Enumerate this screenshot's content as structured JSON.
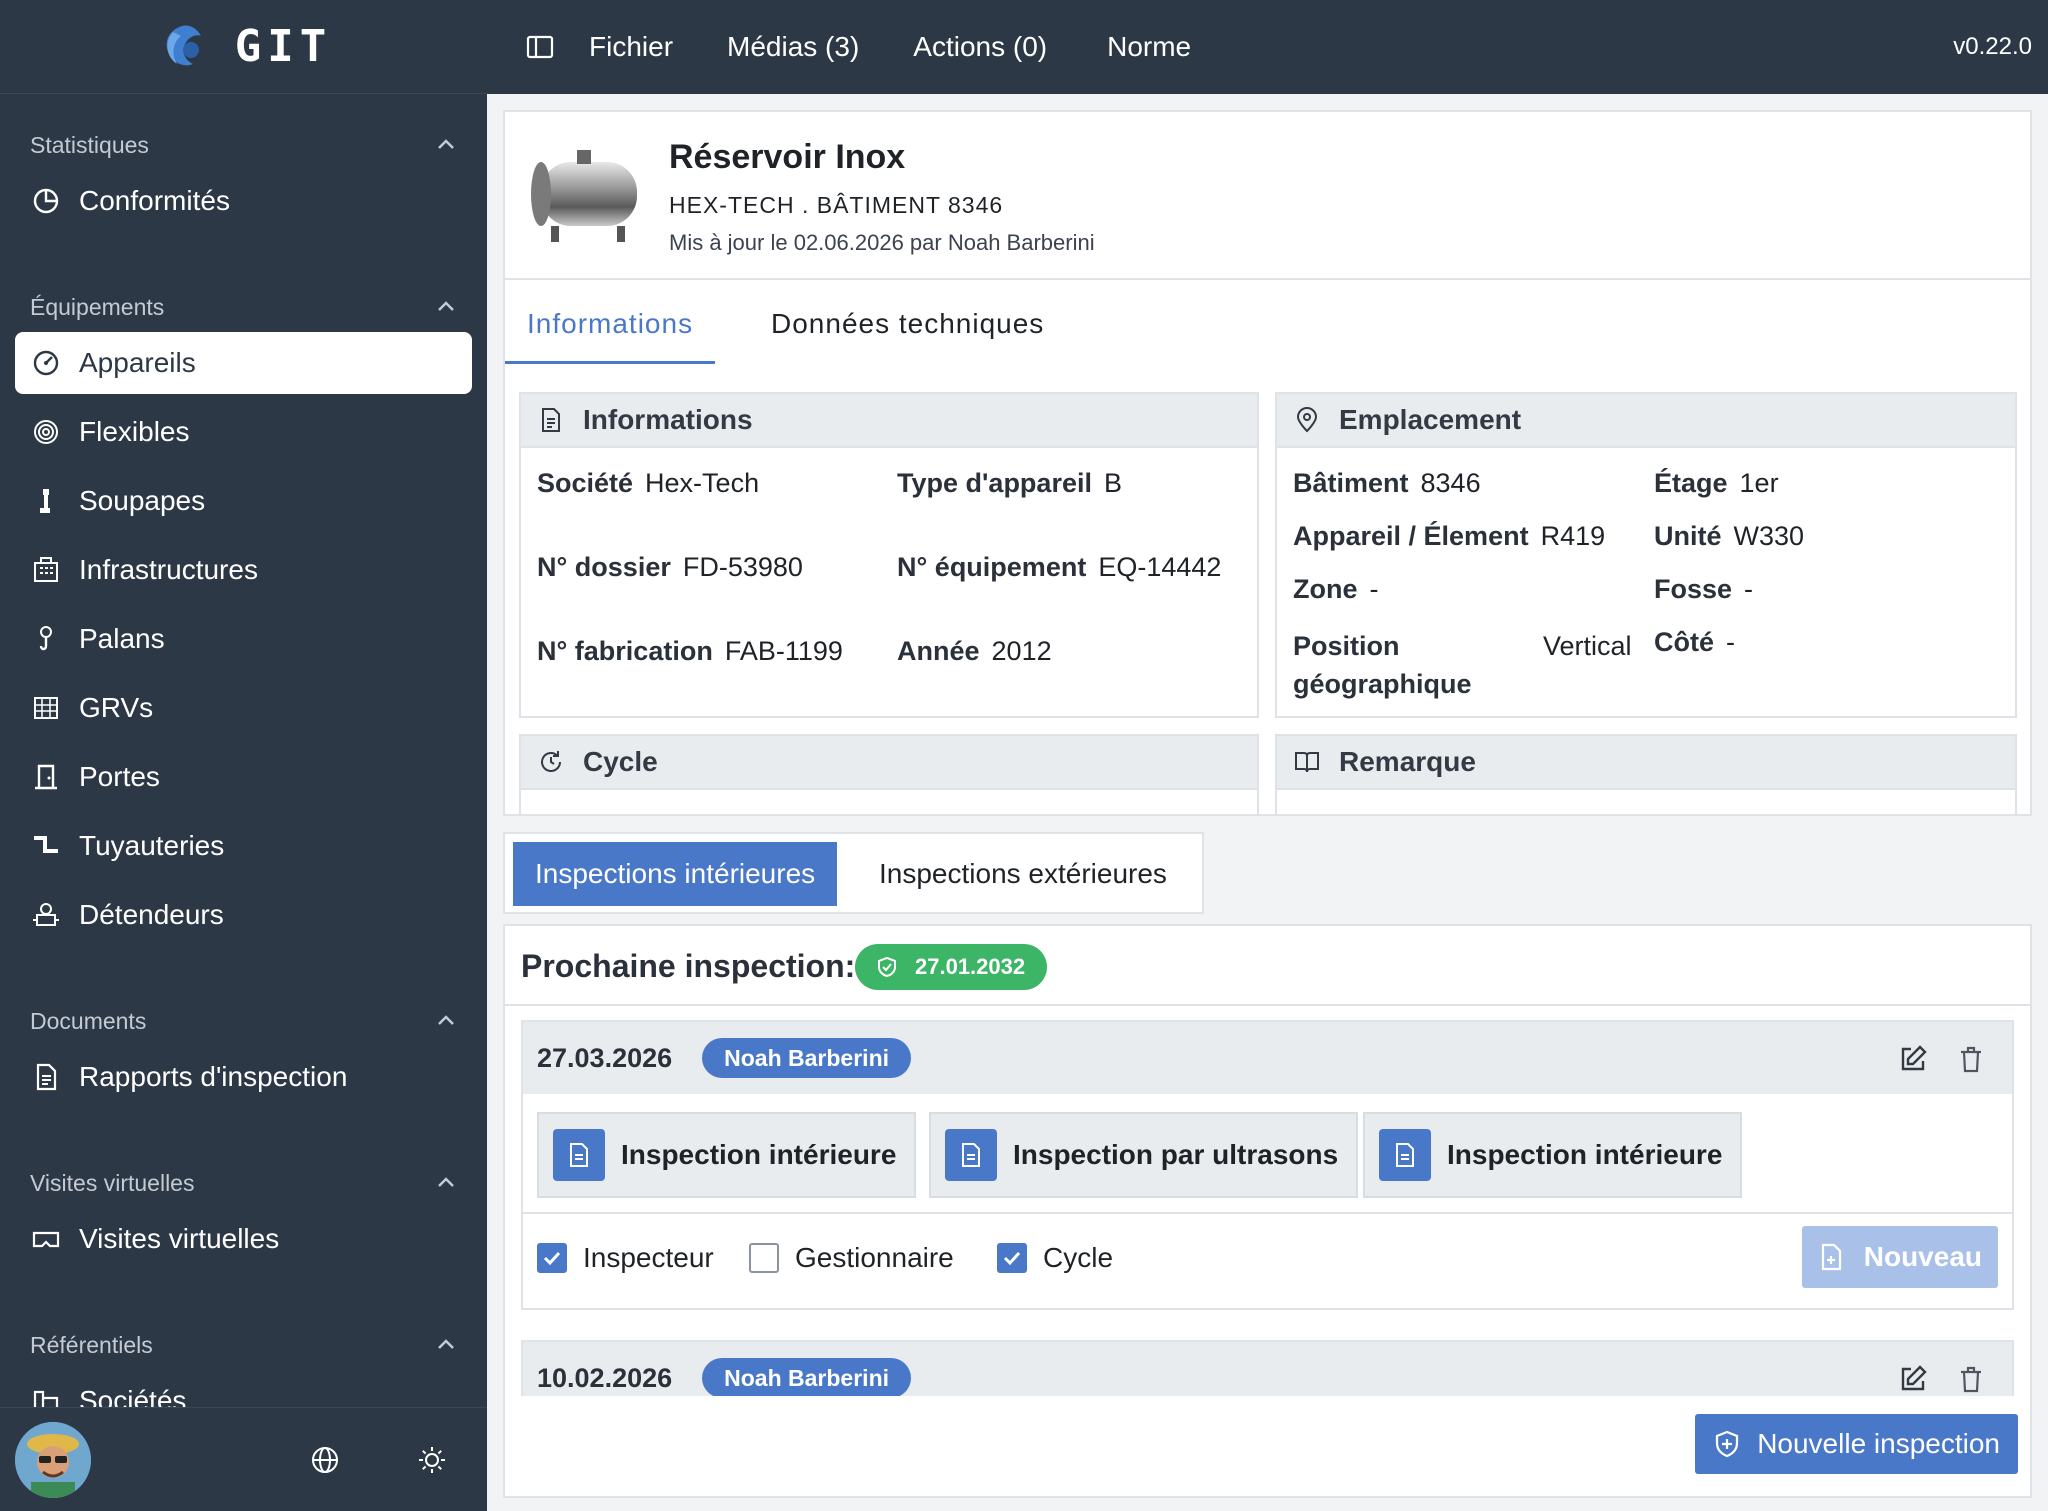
{
  "app": {
    "name": "GIT",
    "version": "v0.22.0"
  },
  "topbar": {
    "menu": [
      "Fichier",
      "Médias (3)",
      "Actions (0)",
      "Norme"
    ]
  },
  "sidebar": {
    "sections": [
      {
        "title": "Statistiques",
        "items": [
          {
            "label": "Conformités",
            "icon": "pie-chart-icon"
          }
        ]
      },
      {
        "title": "Équipements",
        "items": [
          {
            "label": "Appareils",
            "icon": "gauge-icon",
            "active": true
          },
          {
            "label": "Flexibles",
            "icon": "spiral-icon"
          },
          {
            "label": "Soupapes",
            "icon": "valve-icon"
          },
          {
            "label": "Infrastructures",
            "icon": "building-icon"
          },
          {
            "label": "Palans",
            "icon": "hoist-icon"
          },
          {
            "label": "GRVs",
            "icon": "container-icon"
          },
          {
            "label": "Portes",
            "icon": "door-icon"
          },
          {
            "label": "Tuyauteries",
            "icon": "pipe-icon"
          },
          {
            "label": "Détendeurs",
            "icon": "regulator-icon"
          }
        ]
      },
      {
        "title": "Documents",
        "items": [
          {
            "label": "Rapports d'inspection",
            "icon": "document-icon"
          }
        ]
      },
      {
        "title": "Visites virtuelles",
        "items": [
          {
            "label": "Visites virtuelles",
            "icon": "vr-headset-icon"
          }
        ]
      },
      {
        "title": "Référentiels",
        "items": [
          {
            "label": "Sociétés",
            "icon": "company-icon"
          }
        ]
      }
    ]
  },
  "equipment": {
    "title": "Réservoir Inox",
    "subtitle": "HEX-TECH . BÂTIMENT 8346",
    "updated": "Mis à jour le 02.06.2026 par Noah Barberini"
  },
  "tabs": [
    "Informations",
    "Données techniques"
  ],
  "informations": {
    "title": "Informations",
    "fields": [
      {
        "label": "Société",
        "value": "Hex-Tech"
      },
      {
        "label": "Type d'appareil",
        "value": "B"
      },
      {
        "label": "N° dossier",
        "value": "FD-53980"
      },
      {
        "label": "N° équipement",
        "value": "EQ-14442"
      },
      {
        "label": "N° fabrication",
        "value": "FAB-1199"
      },
      {
        "label": "Année",
        "value": "2012"
      }
    ]
  },
  "emplacement": {
    "title": "Emplacement",
    "fields": [
      {
        "label": "Bâtiment",
        "value": "8346"
      },
      {
        "label": "Étage",
        "value": "1er"
      },
      {
        "label": "Appareil / Élement",
        "value": "R419"
      },
      {
        "label": "Unité",
        "value": "W330"
      },
      {
        "label": "Zone",
        "value": "-"
      },
      {
        "label": "Fosse",
        "value": "-"
      },
      {
        "label": "Position géographique",
        "value": "Vertical"
      },
      {
        "label": "Côté",
        "value": "-"
      }
    ]
  },
  "cycle": {
    "title": "Cycle"
  },
  "remarque": {
    "title": "Remarque"
  },
  "inspection_tabs": [
    "Inspections intérieures",
    "Inspections extérieures"
  ],
  "next_inspection": {
    "label": "Prochaine inspection:",
    "date": "27.01.2032"
  },
  "inspections": [
    {
      "date": "27.03.2026",
      "inspector": "Noah Barberini",
      "documents": [
        "Inspection intérieure",
        "Inspection par ultrasons",
        "Inspection intérieure"
      ],
      "checks": [
        {
          "label": "Inspecteur",
          "checked": true
        },
        {
          "label": "Gestionnaire",
          "checked": false
        },
        {
          "label": "Cycle",
          "checked": true
        }
      ],
      "new_label": "Nouveau"
    },
    {
      "date": "10.02.2026",
      "inspector": "Noah Barberini"
    }
  ],
  "new_inspection_label": "Nouvelle inspection",
  "colors": {
    "sidebar": "#2d3846",
    "accent": "#4a78c9",
    "success": "#3cb567"
  }
}
